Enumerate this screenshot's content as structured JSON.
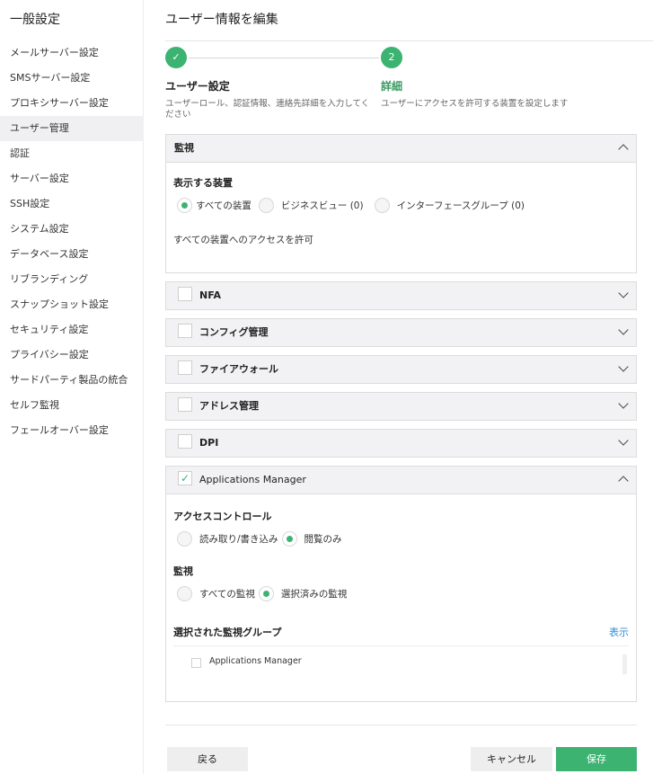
{
  "sidebar": {
    "title": "一般設定",
    "items": [
      {
        "label": "メールサーバー設定"
      },
      {
        "label": "SMSサーバー設定"
      },
      {
        "label": "プロキシサーバー設定"
      },
      {
        "label": "ユーザー管理",
        "active": true
      },
      {
        "label": "認証"
      },
      {
        "label": "サーバー設定"
      },
      {
        "label": "SSH設定"
      },
      {
        "label": "システム設定"
      },
      {
        "label": "データベース設定"
      },
      {
        "label": "リブランディング"
      },
      {
        "label": "スナップショット設定"
      },
      {
        "label": "セキュリティ設定"
      },
      {
        "label": "プライバシー設定"
      },
      {
        "label": "サードパーティ製品の統合"
      },
      {
        "label": "セルフ監視"
      },
      {
        "label": "フェールオーバー設定"
      }
    ]
  },
  "main": {
    "title": "ユーザー情報を編集",
    "steps": [
      {
        "marker": "✓",
        "title": "ユーザー設定",
        "desc": "ユーザーロール、認証情報、連絡先詳細を入力してください"
      },
      {
        "marker": "2",
        "title": "詳細",
        "desc": "ユーザーにアクセスを許可する装置を設定します"
      }
    ],
    "monitor_panel": {
      "title": "監視",
      "section_label": "表示する装置",
      "options": [
        "すべての装置",
        "ビジネスビュー (0)",
        "インターフェースグループ (0)"
      ],
      "selected": "すべての装置",
      "info": "すべての装置へのアクセスを許可"
    },
    "modules": [
      {
        "label": "NFA",
        "checked": false
      },
      {
        "label": "コンフィグ管理",
        "checked": false
      },
      {
        "label": "ファイアウォール",
        "checked": false
      },
      {
        "label": "アドレス管理",
        "checked": false
      },
      {
        "label": "DPI",
        "checked": false
      }
    ],
    "apm_panel": {
      "title": "Applications Manager",
      "checked": true,
      "access_label": "アクセスコントロール",
      "access_options": [
        "読み取り/書き込み",
        "閲覧のみ"
      ],
      "access_selected": "閲覧のみ",
      "monitor_label": "監視",
      "monitor_options": [
        "すべての監視",
        "選択済みの監視"
      ],
      "monitor_selected": "選択済みの監視",
      "groups_label": "選択された監視グループ",
      "show_link": "表示",
      "group_items": [
        "Applications Manager"
      ]
    },
    "buttons": {
      "back": "戻る",
      "cancel": "キャンセル",
      "save": "保存"
    }
  },
  "colors": {
    "accent": "#3cb371",
    "link": "#2b8fd6",
    "panel_header": "#f2f2f4"
  }
}
